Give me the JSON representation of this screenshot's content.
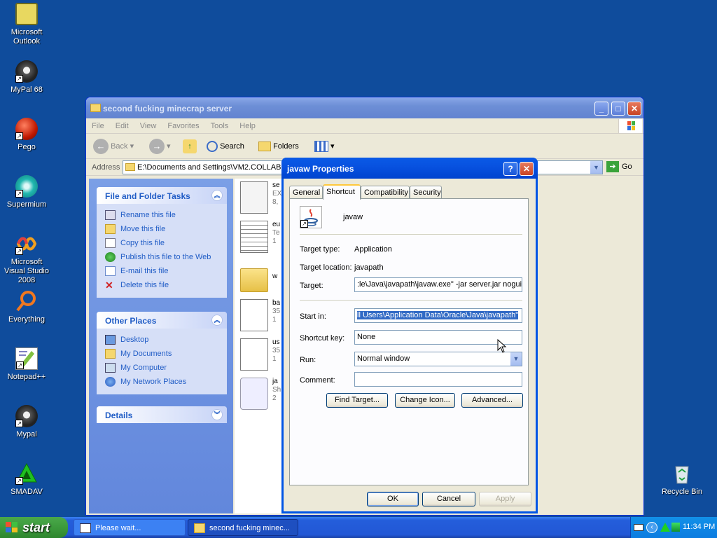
{
  "desktop": {
    "icons": [
      {
        "label": "Microsoft Outlook"
      },
      {
        "label": "MyPal 68"
      },
      {
        "label": "Pego"
      },
      {
        "label": "Supermium"
      },
      {
        "label": "Microsoft Visual Studio 2008"
      },
      {
        "label": "Everything"
      },
      {
        "label": "Notepad++"
      },
      {
        "label": "Mypal"
      },
      {
        "label": "SMADAV"
      },
      {
        "label": "Recycle Bin"
      }
    ]
  },
  "explorer": {
    "title": "second fucking minecrap server",
    "menu": [
      "File",
      "Edit",
      "View",
      "Favorites",
      "Tools",
      "Help"
    ],
    "toolbar": {
      "back": "Back",
      "search": "Search",
      "folders": "Folders"
    },
    "address": {
      "label": "Address",
      "value": "E:\\Documents and Settings\\VM2.COLLABNE",
      "go": "Go"
    },
    "file_tasks": {
      "title": "File and Folder Tasks",
      "items": [
        "Rename this file",
        "Move this file",
        "Copy this file",
        "Publish this file to the Web",
        "E-mail this file",
        "Delete this file"
      ]
    },
    "other_places": {
      "title": "Other Places",
      "items": [
        "Desktop",
        "My Documents",
        "My Computer",
        "My Network Places"
      ]
    },
    "details": {
      "title": "Details"
    },
    "files": [
      {
        "name": "se",
        "line2": "EX",
        "line3": "8,"
      },
      {
        "name": "eu",
        "line2": "Te",
        "line3": "1"
      },
      {
        "name": "w",
        "line2": "",
        "line3": ""
      },
      {
        "name": "ba",
        "line2": "35",
        "line3": "1"
      },
      {
        "name": "us",
        "line2": "35",
        "line3": "1"
      },
      {
        "name": "ja",
        "line2": "Sh",
        "line3": "2"
      }
    ]
  },
  "dialog": {
    "title": "javaw Properties",
    "tabs": [
      "General",
      "Shortcut",
      "Compatibility",
      "Security"
    ],
    "name": "javaw",
    "target_type_label": "Target type:",
    "target_type": "Application",
    "target_location_label": "Target location:",
    "target_location": "javapath",
    "target_label": "Target:",
    "target": ":le\\Java\\javapath\\javaw.exe\" -jar server.jar nogui",
    "start_in_label": "Start in:",
    "start_in": "ll Users\\Application Data\\Oracle\\Java\\javapath\"",
    "shortcut_key_label": "Shortcut key:",
    "shortcut_key": "None",
    "run_label": "Run:",
    "run": "Normal window",
    "comment_label": "Comment:",
    "comment": "",
    "buttons": {
      "find_target": "Find Target...",
      "change_icon": "Change Icon...",
      "advanced": "Advanced..."
    },
    "footer": {
      "ok": "OK",
      "cancel": "Cancel",
      "apply": "Apply"
    }
  },
  "taskbar": {
    "start": "start",
    "tasks": [
      {
        "label": "Please wait..."
      },
      {
        "label": "second fucking minec..."
      }
    ],
    "clock": "11:34 PM"
  }
}
